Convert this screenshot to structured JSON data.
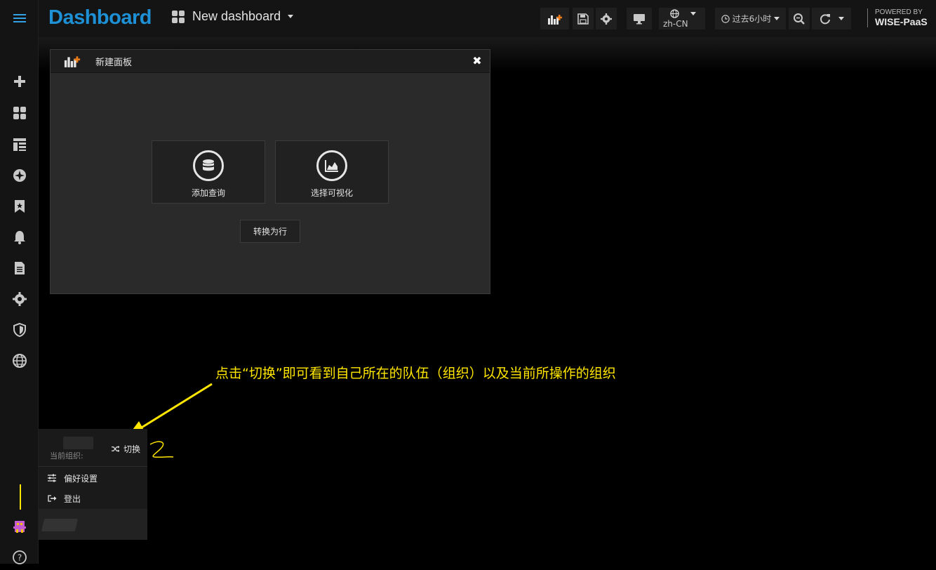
{
  "sidebar": {
    "items": [
      "menu",
      "create",
      "dashboards",
      "panels",
      "explore",
      "starred",
      "alerts",
      "reports",
      "configuration",
      "shield",
      "globe"
    ],
    "help_label": "?"
  },
  "topnav": {
    "brand": "Dashboard",
    "dashboard_title": "New dashboard",
    "lang": "zh-CN",
    "timepicker_label": "过去6小时",
    "powered_line1": "POWERED BY",
    "powered_line2": "WISE-PaaS"
  },
  "panel": {
    "title": "新建面板",
    "add_query_label": "添加查询",
    "choose_viz_label": "选择可视化",
    "convert_row_label": "转换为行"
  },
  "annotation": {
    "text": "点击“切换”即可看到自己所在的队伍（组织）以及当前所操作的组织"
  },
  "profile_menu": {
    "current_org_label": "当前组织:",
    "switch_label": "切换",
    "preferences_label": "偏好设置",
    "logout_label": "登出"
  },
  "colors": {
    "brand": "#1d90d6",
    "annotation": "#ffe600",
    "accent": "#eb7b18"
  }
}
